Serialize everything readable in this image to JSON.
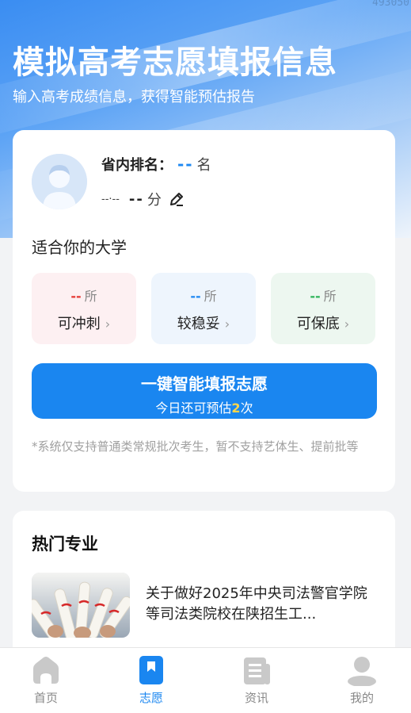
{
  "watermark": "493050",
  "hero": {
    "title": "模拟高考志愿填报信息",
    "subtitle": "输入高考成绩信息，获得智能预估报告"
  },
  "profile": {
    "rank_label": "省内排名：",
    "rank_value": "--",
    "rank_unit": "名",
    "score_subject": "--·--",
    "score_value": "--",
    "score_unit": "分"
  },
  "universities": {
    "title": "适合你的大学",
    "items": [
      {
        "count": "--",
        "count_unit": "所",
        "label": "可冲刺",
        "accent": "#e53935",
        "bg": "#fdf0f2"
      },
      {
        "count": "--",
        "count_unit": "所",
        "label": "较稳妥",
        "accent": "#1e88f2",
        "bg": "#eef5fd"
      },
      {
        "count": "--",
        "count_unit": "所",
        "label": "可保底",
        "accent": "#2fb45a",
        "bg": "#edf7f0"
      }
    ]
  },
  "cta": {
    "title": "一键智能填报志愿",
    "sub_prefix": "今日还可预估",
    "sub_count": "2",
    "sub_suffix": "次"
  },
  "disclaimer": "*系统仅支持普通类常规批次考生，暂不支持艺体生、提前批等",
  "hot": {
    "title": "热门专业",
    "news_title": "关于做好2025年中央司法警官学院等司法类院校在陕招生工..."
  },
  "tabs": [
    {
      "label": "首页",
      "icon": "home-icon",
      "active": false
    },
    {
      "label": "志愿",
      "icon": "bookmark-icon",
      "active": true
    },
    {
      "label": "资讯",
      "icon": "news-icon",
      "active": false
    },
    {
      "label": "我的",
      "icon": "profile-icon",
      "active": false
    }
  ],
  "colors": {
    "primary": "#1a86f0",
    "highlight": "#ffd54a"
  }
}
